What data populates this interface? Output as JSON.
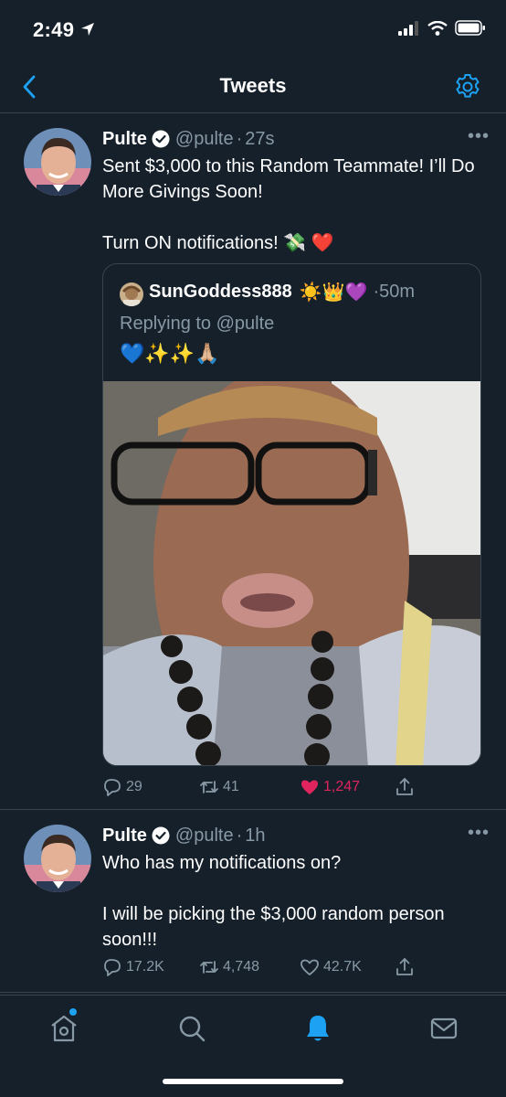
{
  "status": {
    "time": "2:49"
  },
  "nav": {
    "title": "Tweets"
  },
  "tweets": [
    {
      "name": "Pulte",
      "handle": "@pulte",
      "time": "27s",
      "text": "Sent $3,000 to this Random Teammate! I’ll Do More Givings Soon!\n\nTurn ON notifications! 💸 ❤️",
      "quote": {
        "name": "SunGoddess888",
        "emoji": "☀️👑💜",
        "time": "50m",
        "reply_prefix": "Replying to ",
        "reply_mention": "@pulte",
        "text": "💙✨✨🙏🏼"
      },
      "replies": "29",
      "retweets": "41",
      "likes": "1,247",
      "liked": true
    },
    {
      "name": "Pulte",
      "handle": "@pulte",
      "time": "1h",
      "text": "Who has my notifications on?\n\nI will be picking the $3,000 random person soon!!!",
      "replies": "17.2K",
      "retweets": "4,748",
      "likes": "42.7K",
      "liked": false
    }
  ],
  "colors": {
    "background": "#15202b",
    "accent": "#1da1f2",
    "muted": "#8899a6",
    "like": "#e0245e",
    "border": "#38444d"
  },
  "icons": {
    "back": "chevron-left-icon",
    "settings": "gear-icon",
    "verified": "verified-badge-icon",
    "reply": "reply-icon",
    "retweet": "retweet-icon",
    "like": "heart-icon",
    "share": "share-icon",
    "home": "home-icon",
    "search": "search-icon",
    "notifications": "bell-icon",
    "messages": "mail-icon"
  }
}
